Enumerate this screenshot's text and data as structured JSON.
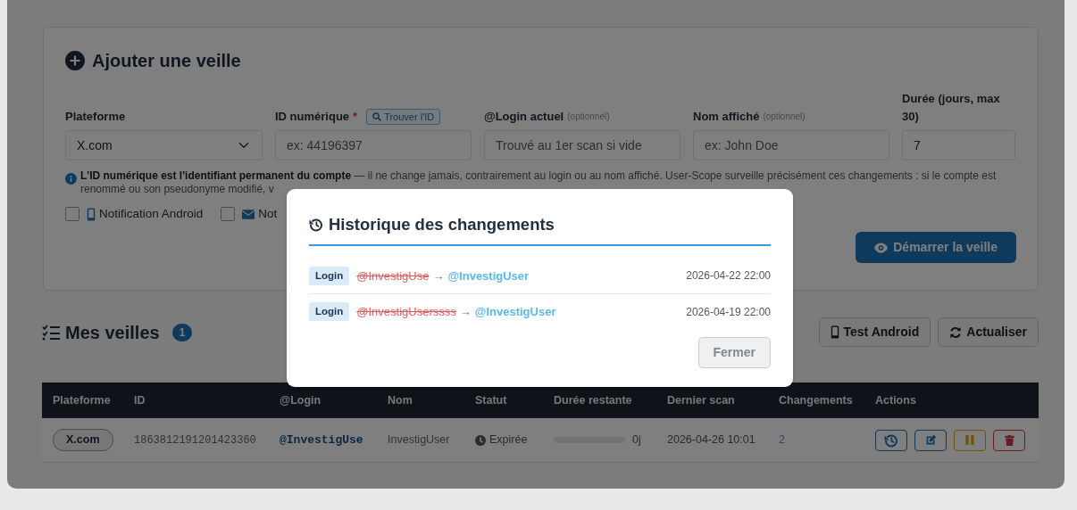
{
  "form": {
    "title": "Ajouter une veille",
    "fields": [
      {
        "kind": "select",
        "label": "Plateforme",
        "value": "X.com"
      },
      {
        "kind": "input",
        "label": "ID numérique",
        "required_mark": "*",
        "action": "Trouver l'ID",
        "placeholder": "ex: 44196397"
      },
      {
        "kind": "input",
        "label": "@Login actuel",
        "hint": "(optionnel)",
        "placeholder": "Trouvé au 1er scan si vide"
      },
      {
        "kind": "input",
        "label": "Nom affiché",
        "hint": "(optionnel)",
        "placeholder": "ex: John Doe"
      },
      {
        "kind": "input",
        "label": "Durée (jours, max 30)",
        "value": "7"
      }
    ],
    "info": "**L'ID numérique est l'identifiant permanent du compte** — il ne change jamais, contrairement au login ou au nom affiché. User-Scope surveille précisément ces changements : si le compte est renommé ou son pseudonyme modifié, v",
    "checkboxes": [
      {
        "kind": "phone",
        "label": "Notification Android",
        "checked": false
      },
      {
        "kind": "mail",
        "label": "Not",
        "checked": false
      }
    ],
    "submit_button": "Démarrer la veille"
  },
  "watches": {
    "title": "Mes veilles",
    "count": "1",
    "buttons": [
      {
        "kind": "phone",
        "label": "Test Android"
      },
      {
        "kind": "refresh",
        "label": "Actualiser"
      }
    ],
    "table": {
      "columns": [
        "Plateforme",
        "ID",
        "@Login",
        "Nom",
        "Statut",
        "Durée restante",
        "Dernier scan",
        "Changements",
        "Actions"
      ],
      "rows": [
        {
          "platform": "X.com",
          "id": "1863812191201423360",
          "login": "@InvestigUse",
          "name": "InvestigUser",
          "status": "Expirée",
          "level": 0,
          "remaining": "0j",
          "last_scan": "2026-04-26 10:01",
          "changes": "2"
        }
      ]
    }
  },
  "modal": {
    "title": "Historique des changements",
    "entries": [
      {
        "type": "Login",
        "old": "@InvestigUse",
        "arrow": "→",
        "new": "@InvestigUser",
        "date": "2026-04-22 22:00"
      },
      {
        "type": "Login",
        "old": "@InvestigUserssss",
        "arrow": "→",
        "new": "@InvestigUser",
        "date": "2026-04-19 22:00"
      }
    ],
    "close_button": "Fermer"
  }
}
